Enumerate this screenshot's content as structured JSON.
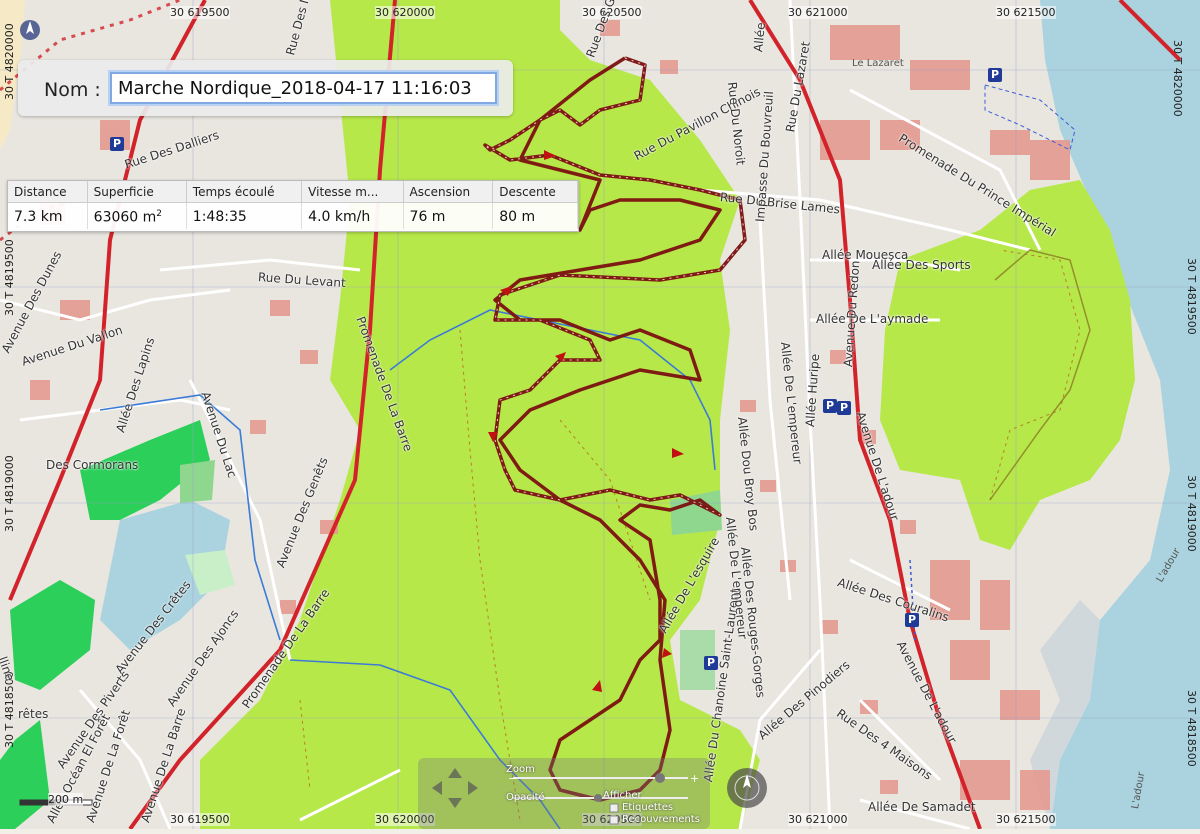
{
  "name_panel": {
    "label": "Nom :",
    "value": "Marche Nordique_2018-04-17 11:16:03"
  },
  "stats": {
    "headers": [
      "Distance",
      "Superficie",
      "Temps écoulé",
      "Vitesse m...",
      "Ascension",
      "Descente"
    ],
    "values": [
      "7.3 km",
      "63060 m",
      "1:48:35",
      "4.0 km/h",
      "76 m",
      "80 m"
    ],
    "area_unit_sup": "2"
  },
  "grid": {
    "top_labels": [
      "30 619500",
      "30 620000",
      "30 620500",
      "30 621000",
      "30 621500"
    ],
    "bottom_labels": [
      "30 619500",
      "30 620000",
      "30 620500",
      "30 621000",
      "30 621500"
    ],
    "left_labels": [
      "30 T 4820000",
      "30 T 4819500",
      "30 T 4819000",
      "30 T 4818500"
    ],
    "right_labels": [
      "30 T 4820000",
      "30 T 4819500",
      "30 T 4819000",
      "30 T 4818500"
    ]
  },
  "streets": {
    "s1": "Rue Du Pavillon Chinois",
    "s2": "Rue Du Brise Lames",
    "s3": "Rue Du Levant",
    "s4": "Promenade De La Barre",
    "s5": "Avenue Des Dunes",
    "s6": "Avenue Du Vallon",
    "s7": "Allée Des Lapins",
    "s8": "Avenue Du Lac",
    "s9": "Des Cormorans",
    "s10": "Avenue Des Genêts",
    "s11": "Avenue Des Crêtes",
    "s12": "Avenue Des Ajoncs",
    "s13": "Promenade De La Barre",
    "s14": "Avenue Des Piverts",
    "s15": "Allée Océan El Forêt",
    "s16": "Avenue De La Forêt",
    "s17": "Avenue De La Barre",
    "s18": "Rue Du Noroit",
    "s19": "Rue Du Lazaret",
    "s20": "Promenade Du Prince Impérial",
    "s21": "Allée Mouesca",
    "s22": "Allée Des Sports",
    "s23": "Allée De L'aymade",
    "s24": "Impasse Du Bouvreuil",
    "s25": "Allée De L'empereur",
    "s26": "Allée Dou Broy Bos",
    "s27": "Allée De L'esquire",
    "s28": "Allée Du Chanoine Saint-Laurent",
    "s29": "Allée Des Rouges-Gorges",
    "s30": "Allée Des Couralins",
    "s31": "Avenue De L'adour",
    "s32": "Avenue Du Redon",
    "s33": "Allée Des Pinodiers",
    "s34": "Rue Des 4 Maisons",
    "s35": "Allée De Samadet",
    "s36": "Avenue De L'adour",
    "s37": "Rue Des Dalliers",
    "s38": "Rue Des Mésanges",
    "s39": "Allée",
    "s40": "Le Lazaret",
    "s41": "Allée Huripe",
    "s42": "Rue Des Gab",
    "s43": "rêtes",
    "s44": "lline",
    "s45": "L'adour",
    "s46": "L'adour"
  },
  "map_controls": {
    "zoom_label": "Zoom",
    "opacity_label": "Opacité",
    "show_label": "Afficher",
    "labels_label": "Etiquettes",
    "overlaps_label": "Recouvrements",
    "scale_label": "200 m"
  },
  "colors": {
    "track": "#7a1010",
    "forest": "#b7e84a",
    "water": "#aad3df",
    "road_major": "#d2232a",
    "building": "#e39a91"
  }
}
